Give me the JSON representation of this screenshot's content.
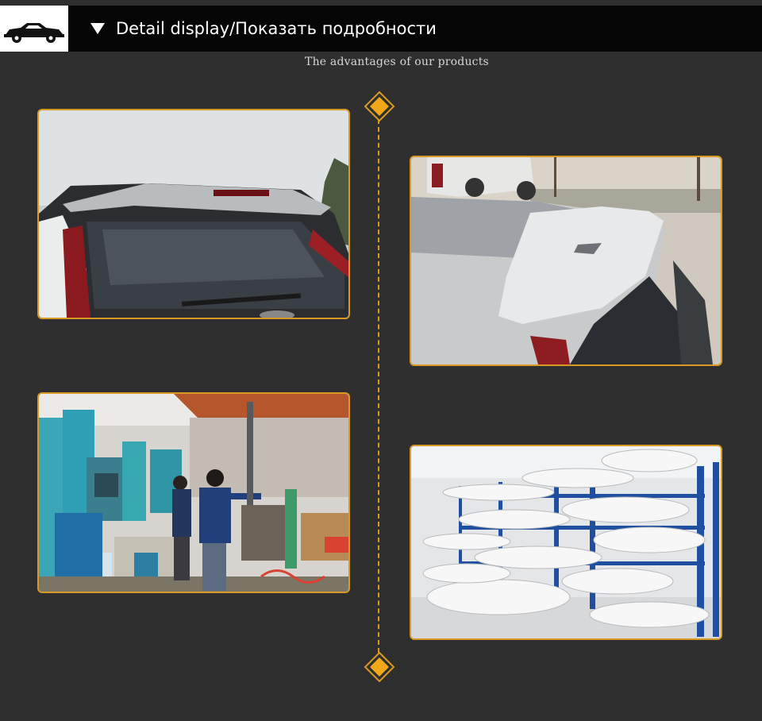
{
  "header": {
    "title": "Detail display/Показать подробности",
    "logo_icon": "car-icon",
    "triangle_icon": "triangle-down-icon"
  },
  "subtitle": "The advantages of our products",
  "colors": {
    "background": "#2f2f2f",
    "header_bg": "#050505",
    "accent": "#d89a24",
    "diamond_fill": "#f2a71b"
  },
  "photos": [
    {
      "name": "spoiler-rear-view-photo"
    },
    {
      "name": "spoiler-side-view-photo"
    },
    {
      "name": "factory-workers-photo"
    },
    {
      "name": "warehouse-racks-photo"
    }
  ]
}
